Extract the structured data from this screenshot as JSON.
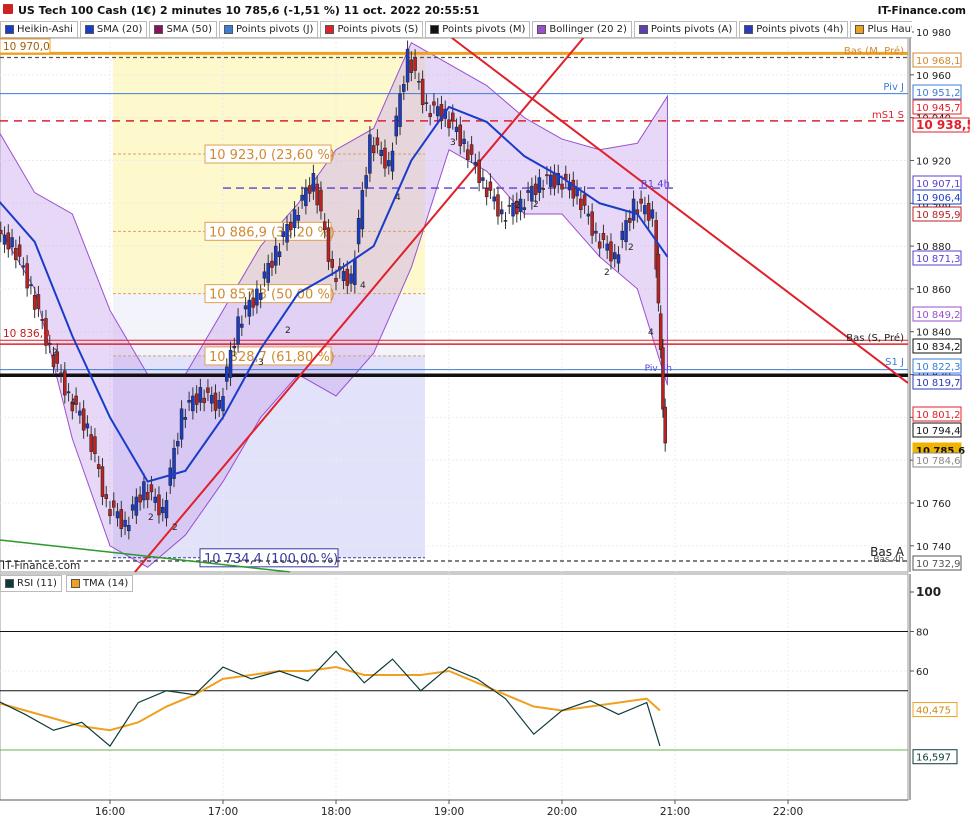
{
  "header": {
    "title": "US Tech 100 Cash (1€) 2 minutes 10 785,6 (-1,51 %) 11 oct. 2022 20:55:51",
    "brand": "IT-Finance.com",
    "watermark": "IT-Finance.com"
  },
  "legend": [
    {
      "label": "Heikin-Ashi",
      "color": "#1a3cc8"
    },
    {
      "label": "SMA (20)",
      "color": "#1a3cc8"
    },
    {
      "label": "SMA (50)",
      "color": "#8b1060"
    },
    {
      "label": "Points pivots (J)",
      "color": "#3b7dd8"
    },
    {
      "label": "Points pivots (S)",
      "color": "#e0202a"
    },
    {
      "label": "Points pivots (M)",
      "color": "#111111"
    },
    {
      "label": "Bollinger (20 2)",
      "color": "#9a4fd0"
    },
    {
      "label": "Points pivots (A)",
      "color": "#5b3fb0"
    },
    {
      "label": "Points pivots (4h)",
      "color": "#2b3ab8"
    },
    {
      "label": "Plus Haut (J)",
      "color": "#f0a020"
    },
    {
      "label": "Plu",
      "color": "#555555"
    }
  ],
  "rsi_legend": [
    {
      "label": "RSI (11)",
      "color": "#0d3b3b"
    },
    {
      "label": "TMA (14)",
      "color": "#f0a020"
    }
  ],
  "colors": {
    "accent_red": "#e0202a",
    "fib_box": "#fdf8c8",
    "fib_box2": "#d8d8f8",
    "sma20": "#1a3cc8",
    "rsi": "#0d3b3b",
    "tma": "#f0a020",
    "last_price_bg": "#f0b400"
  },
  "chart_data": [
    {
      "type": "line",
      "title": "US Tech 100 Cash (1€) 2 minutes",
      "x_ticks": [
        "16:00",
        "17:00",
        "18:00",
        "19:00",
        "20:00",
        "21:00",
        "22:00"
      ],
      "y_ticks": [
        10980,
        10960,
        10940,
        10920,
        10900,
        10880,
        10860,
        10840,
        10820,
        10800,
        10780,
        10760,
        10740
      ],
      "ylim": [
        10729,
        10984
      ],
      "grid": true,
      "last_price": 10785.6,
      "series": [
        {
          "name": "Heikin-Ashi",
          "x": [
            "15:00",
            "15:10",
            "15:20",
            "15:30",
            "15:40",
            "15:50",
            "16:00",
            "16:10",
            "16:20",
            "16:30",
            "16:40",
            "16:50",
            "17:00",
            "17:10",
            "17:20",
            "17:30",
            "17:40",
            "17:50",
            "18:00",
            "18:10",
            "18:20",
            "18:30",
            "18:40",
            "18:50",
            "19:00",
            "19:10",
            "19:20",
            "19:30",
            "19:40",
            "19:50",
            "20:00",
            "20:10",
            "20:20",
            "20:30",
            "20:40",
            "20:50",
            "20:56"
          ],
          "values": [
            10885,
            10882,
            10860,
            10832,
            10810,
            10795,
            10760,
            10750,
            10768,
            10756,
            10802,
            10812,
            10806,
            10845,
            10858,
            10878,
            10895,
            10912,
            10868,
            10865,
            10930,
            10918,
            10970,
            10945,
            10942,
            10928,
            10910,
            10895,
            10900,
            10910,
            10912,
            10905,
            10885,
            10875,
            10900,
            10895,
            10786
          ]
        },
        {
          "name": "SMA (20)",
          "x": [
            "15:00",
            "15:20",
            "15:40",
            "16:00",
            "16:20",
            "16:40",
            "17:00",
            "17:20",
            "17:40",
            "18:00",
            "18:20",
            "18:40",
            "19:00",
            "19:20",
            "19:40",
            "20:00",
            "20:20",
            "20:40",
            "20:56"
          ],
          "values": [
            10902,
            10882,
            10838,
            10800,
            10770,
            10775,
            10800,
            10832,
            10858,
            10868,
            10880,
            10920,
            10945,
            10938,
            10922,
            10912,
            10900,
            10895,
            10875
          ]
        }
      ],
      "bands": [
        {
          "name": "Bollinger (20 2)",
          "upper": [
            10935,
            10905,
            10895,
            10850,
            10820,
            10820,
            10850,
            10880,
            10900,
            10925,
            10935,
            10975,
            10965,
            10955,
            10940,
            10930,
            10925,
            10928,
            10950
          ],
          "lower": [
            10890,
            10860,
            10790,
            10740,
            10730,
            10745,
            10770,
            10800,
            10820,
            10810,
            10830,
            10870,
            10925,
            10915,
            10895,
            10895,
            10875,
            10860,
            10815
          ]
        }
      ],
      "levels": [
        {
          "label": "10 970,0",
          "value": 10970.0
        },
        {
          "label": "10 968,1",
          "value": 10968.1,
          "name": "Bas (M, Pré)"
        },
        {
          "label": "10 951,2",
          "value": 10951.2,
          "name": "Piv J"
        },
        {
          "label": "10 945,7",
          "value": 10945.7
        },
        {
          "label": "10 938,5",
          "value": 10938.5,
          "name": "mS1 S"
        },
        {
          "label": "10 907,1",
          "value": 10907.1,
          "name": "R1 4h"
        },
        {
          "label": "10 906,4",
          "value": 10906.4
        },
        {
          "label": "10 895,9",
          "value": 10895.9
        },
        {
          "label": "10 871,3",
          "value": 10871.3
        },
        {
          "label": "10 849,2",
          "value": 10849.2
        },
        {
          "label": "10 836,0",
          "value": 10836.0
        },
        {
          "label": "10 834,2",
          "value": 10834.2,
          "name": "Bas (S, Pré)"
        },
        {
          "label": "10 822,3",
          "value": 10822.3,
          "name": "S1 J"
        },
        {
          "label": "10 819,7",
          "value": 10819.7
        },
        {
          "label": "10 801,2",
          "value": 10801.2
        },
        {
          "label": "10 794,4",
          "value": 10794.4
        },
        {
          "label": "10 785,6",
          "value": 10785.6
        },
        {
          "label": "10 784,6",
          "value": 10784.6
        },
        {
          "label": "10 732,9",
          "value": 10732.9,
          "name": "Bas A"
        }
      ],
      "fibonacci": [
        {
          "label": "10 923,0 (23,60 %)",
          "value": 10923.0
        },
        {
          "label": "10 886,9 (38,20 %)",
          "value": 10886.9
        },
        {
          "label": "10 857,8 (50,00 %)",
          "value": 10857.8
        },
        {
          "label": "10 828,7 (61,80 %)",
          "value": 10828.7
        },
        {
          "label": "10 734,4 (100,00 %)",
          "value": 10734.4
        }
      ]
    },
    {
      "type": "line",
      "title": "RSI (11) / TMA (14)",
      "x_ticks": [
        "16:00",
        "17:00",
        "18:00",
        "19:00",
        "20:00",
        "21:00",
        "22:00"
      ],
      "y_ticks": [
        100,
        80,
        60,
        40,
        20
      ],
      "ylim": [
        0,
        100
      ],
      "last_values": {
        "rsi": 16.597,
        "tma": 40.475
      },
      "series": [
        {
          "name": "RSI (11)",
          "x": [
            "15:00",
            "15:15",
            "15:30",
            "15:45",
            "16:00",
            "16:15",
            "16:30",
            "16:45",
            "17:00",
            "17:15",
            "17:30",
            "17:45",
            "18:00",
            "18:15",
            "18:30",
            "18:45",
            "19:00",
            "19:15",
            "19:30",
            "19:45",
            "20:00",
            "20:15",
            "20:30",
            "20:45",
            "20:52"
          ],
          "values": [
            45,
            38,
            30,
            34,
            22,
            44,
            50,
            48,
            62,
            56,
            60,
            55,
            70,
            54,
            66,
            50,
            62,
            56,
            46,
            28,
            40,
            45,
            38,
            44,
            22
          ]
        },
        {
          "name": "TMA (14)",
          "x": [
            "15:00",
            "15:15",
            "15:30",
            "15:45",
            "16:00",
            "16:15",
            "16:30",
            "16:45",
            "17:00",
            "17:15",
            "17:30",
            "17:45",
            "18:00",
            "18:15",
            "18:30",
            "18:45",
            "19:00",
            "19:15",
            "19:30",
            "19:45",
            "20:00",
            "20:15",
            "20:30",
            "20:45",
            "20:52"
          ],
          "values": [
            44,
            40,
            36,
            32,
            30,
            34,
            42,
            48,
            56,
            58,
            60,
            60,
            62,
            58,
            58,
            58,
            60,
            54,
            48,
            42,
            40,
            42,
            44,
            46,
            40
          ]
        }
      ],
      "levels": [
        {
          "label": "80",
          "value": 80
        },
        {
          "label": "60",
          "value": 60
        },
        {
          "label": "40,475",
          "value": 40.475
        },
        {
          "label": "16,597",
          "value": 16.597
        }
      ]
    }
  ],
  "misc_labels": {
    "pivot_S1_J": "S1 J",
    "pivot_Piv_J": "Piv J",
    "pivot_R1_4h": "R1 4h",
    "pivot_mS1_S": "mS1 S",
    "pivot_Bas_M_Pre": "Bas (M, Pré)",
    "pivot_Bas_S_Pre": "Bas (S, Pré)",
    "pivot_Bas_A": "Bas A",
    "pivot_Piv_4h": "Piv 4h",
    "pivot_bas_4h": "Bas 4h",
    "marker_labels": [
      "4",
      "2",
      "2",
      "2",
      "3",
      "4",
      "3",
      "4",
      "2",
      "2",
      "2",
      "2",
      "2",
      "4"
    ]
  }
}
